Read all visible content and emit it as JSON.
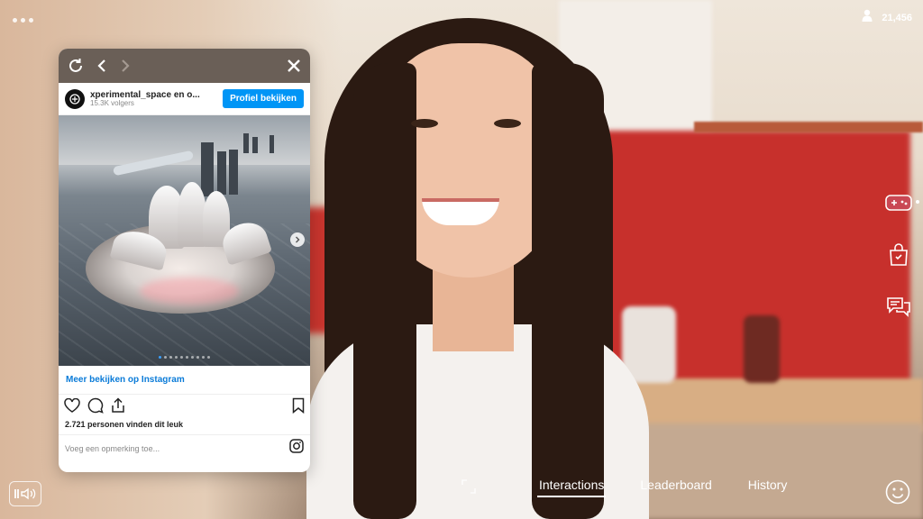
{
  "viewer": {
    "count": "21,456",
    "icon": "person-icon"
  },
  "popup": {
    "toolbar": {
      "refresh_icon": "refresh-icon",
      "back_icon": "chevron-left-icon",
      "forward_icon": "chevron-right-icon",
      "close_icon": "close-icon"
    },
    "profile": {
      "username": "xperimental_space en o...",
      "followers": "15.3K volgers",
      "view_profile_label": "Profiel bekijken"
    },
    "image": {
      "alt": "futuristic building render",
      "slide_count": 10,
      "active_slide": 1
    },
    "more_link": "Meer bekijken op Instagram",
    "likes_text": "2.721 personen vinden dit leuk",
    "comment_placeholder": "Voeg een opmerking toe...",
    "colors": {
      "button": "#0095f6",
      "link": "#0a7bd8",
      "toolbar": "#6a5f57"
    }
  },
  "rail": {
    "items": [
      "gamepad-icon",
      "shopping-bag-icon",
      "chat-icon"
    ]
  },
  "bottom_nav": {
    "tabs": [
      {
        "label": "Interactions",
        "active": true
      },
      {
        "label": "Leaderboard",
        "active": false
      },
      {
        "label": "History",
        "active": false
      }
    ]
  }
}
